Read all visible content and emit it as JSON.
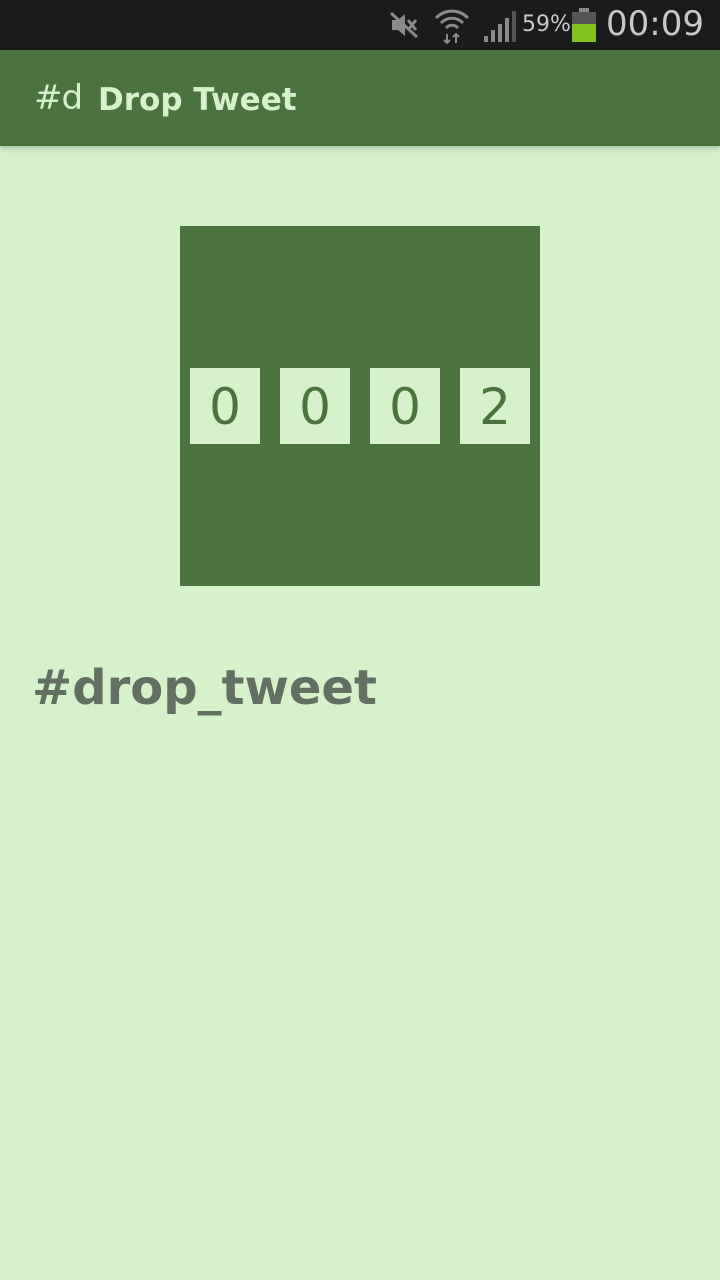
{
  "status_bar": {
    "icons": [
      "mute-icon",
      "wifi-icon",
      "signal-icon",
      "battery-icon"
    ],
    "battery_percent": "59%",
    "battery_level": 0.59,
    "time": "00:09"
  },
  "app_bar": {
    "app_icon_text": "#d",
    "title": "Drop Tweet"
  },
  "counter": {
    "digits": [
      "0",
      "0",
      "0",
      "2"
    ]
  },
  "hashtag": "#drop_tweet",
  "colors": {
    "background": "#d6f2cb",
    "primary": "#4b733d",
    "status_bar": "#1b1b1b",
    "hashtag_text": "#627062",
    "battery_fill": "#7fc31c"
  }
}
